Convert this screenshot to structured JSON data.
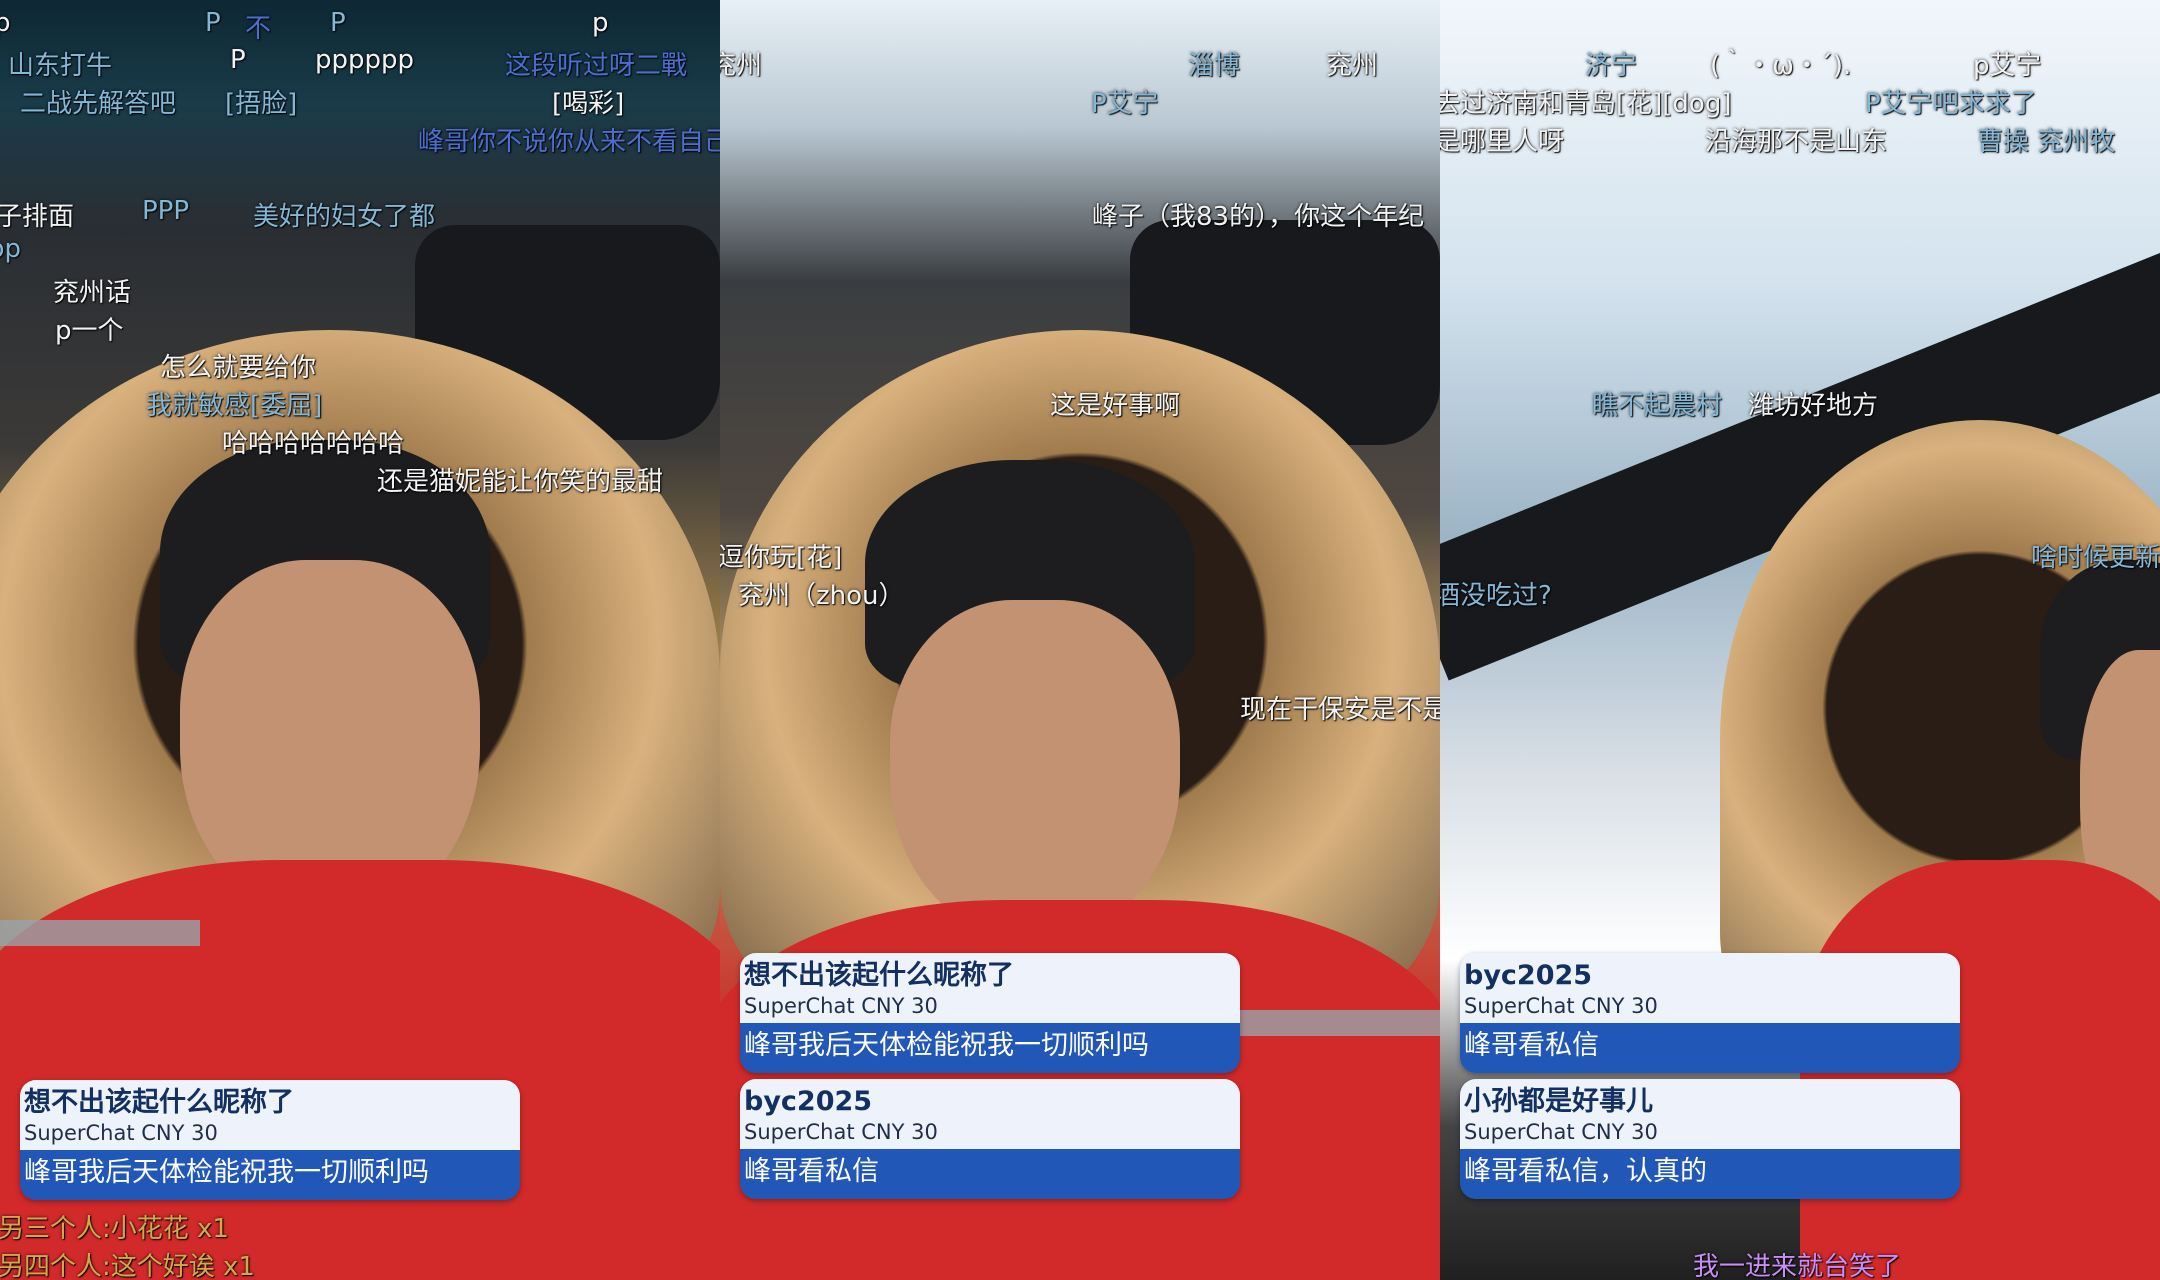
{
  "frames": [
    {
      "danmaku": [
        {
          "text": "p",
          "color": "white"
        },
        {
          "text": "P",
          "color": "blue"
        },
        {
          "text": "不",
          "color": "dblue"
        },
        {
          "text": "P",
          "color": "blue"
        },
        {
          "text": "p",
          "color": "white"
        },
        {
          "text": "山东打牛",
          "color": "blue"
        },
        {
          "text": "P",
          "color": "white"
        },
        {
          "text": "pppppp",
          "color": "white"
        },
        {
          "text": "这段听过呀二戰",
          "color": "dblue"
        },
        {
          "text": "二战先解答吧",
          "color": "blue"
        },
        {
          "text": "[捂脸]",
          "color": "blue"
        },
        {
          "text": "[喝彩]",
          "color": "white"
        },
        {
          "text": "峰哥你不说你从来不看自己",
          "color": "dblue"
        },
        {
          "text": "子排面",
          "color": "white"
        },
        {
          "text": "PPP",
          "color": "blue"
        },
        {
          "text": "美好的妇女了都",
          "color": "blue"
        },
        {
          "text": "pp",
          "color": "blue"
        },
        {
          "text": "兖州话",
          "color": "white"
        },
        {
          "text": "p一个",
          "color": "white"
        },
        {
          "text": "怎么就要给你",
          "color": "white"
        },
        {
          "text": "我就敏感[委屈]",
          "color": "blue"
        },
        {
          "text": "哈哈哈哈哈哈哈",
          "color": "white"
        },
        {
          "text": "还是猫妮能让你笑的最甜",
          "color": "white"
        },
        {
          "text": "另三个人:小花花 x1",
          "color": "gold"
        },
        {
          "text": "另四个人:这个好诶 x1",
          "color": "gold"
        }
      ],
      "superchats": [
        {
          "name": "想不出该起什么昵称了",
          "amount": "SuperChat CNY 30",
          "message": "峰哥我后天体检能祝我一切顺利吗"
        }
      ]
    },
    {
      "danmaku": [
        {
          "text": "兖州",
          "color": "white"
        },
        {
          "text": "淄博",
          "color": "blue"
        },
        {
          "text": "兖州",
          "color": "white"
        },
        {
          "text": "P艾宁",
          "color": "blue"
        },
        {
          "text": "峰子（我83的），你这个年纪",
          "color": "white"
        },
        {
          "text": "这是好事啊",
          "color": "white"
        },
        {
          "text": "逗你玩[花]",
          "color": "white"
        },
        {
          "text": "兖州（zhou）",
          "color": "white"
        },
        {
          "text": "现在干保安是不是",
          "color": "white"
        }
      ],
      "superchats": [
        {
          "name": "想不出该起什么昵称了",
          "amount": "SuperChat CNY 30",
          "message": "峰哥我后天体检能祝我一切顺利吗"
        },
        {
          "name": "byc2025",
          "amount": "SuperChat CNY 30",
          "message": "峰哥看私信"
        }
      ]
    },
    {
      "danmaku": [
        {
          "text": "济宁",
          "color": "blue"
        },
        {
          "text": "(｀・ω・´).",
          "color": "white"
        },
        {
          "text": "p艾宁",
          "color": "white"
        },
        {
          "text": "去过济南和青岛[花][dog]",
          "color": "white"
        },
        {
          "text": "P艾宁吧求求了",
          "color": "blue"
        },
        {
          "text": "是哪里人呀",
          "color": "white"
        },
        {
          "text": "沿海那不是山东",
          "color": "white"
        },
        {
          "text": "曹操 兖州牧",
          "color": "blue"
        },
        {
          "text": "瞧不起農村",
          "color": "blue"
        },
        {
          "text": "潍坊好地方",
          "color": "white"
        },
        {
          "text": "啥时候更新",
          "color": "blue"
        },
        {
          "text": "酒没吃过?",
          "color": "blue"
        },
        {
          "text": "我一进来就台笑了",
          "color": "purple"
        }
      ],
      "superchats": [
        {
          "name": "byc2025",
          "amount": "SuperChat CNY 30",
          "message": "峰哥看私信"
        },
        {
          "name": "小孙都是好事儿",
          "amount": "SuperChat CNY 30",
          "message": "峰哥看私信，认真的"
        }
      ]
    }
  ]
}
